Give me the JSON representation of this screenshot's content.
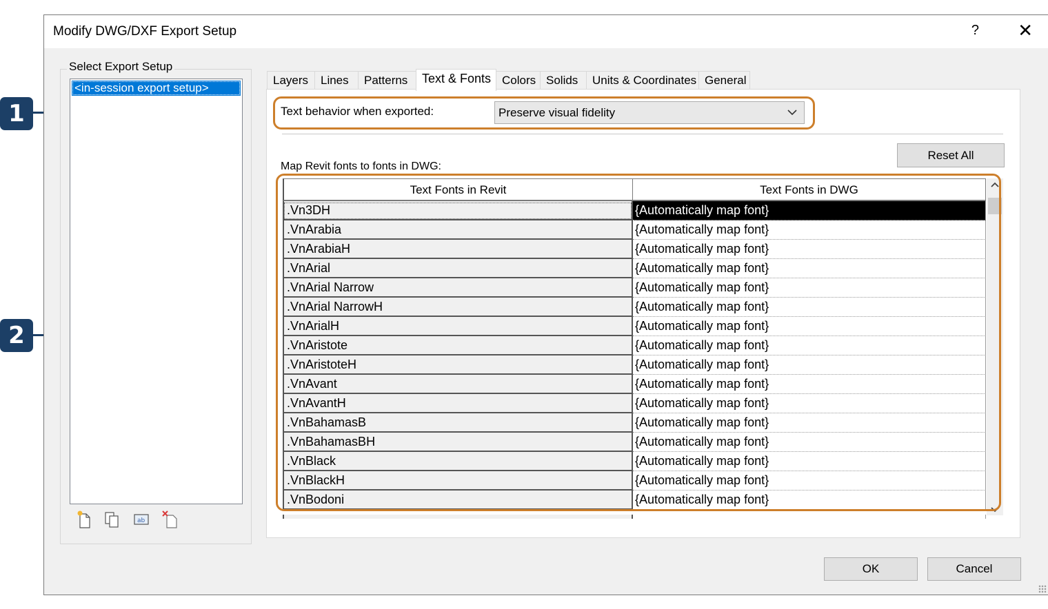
{
  "callouts": [
    "1",
    "2"
  ],
  "dialog": {
    "title": "Modify DWG/DXF Export Setup",
    "help": "?",
    "close": "✕"
  },
  "setup": {
    "group_label": "Select Export Setup",
    "items": [
      "<in-session export setup>"
    ]
  },
  "tabs": [
    "Layers",
    "Lines",
    "Patterns",
    "Text & Fonts",
    "Colors",
    "Solids",
    "Units & Coordinates",
    "General"
  ],
  "active_tab": "Text & Fonts",
  "text_behavior": {
    "label": "Text behavior when exported:",
    "value": "Preserve visual fidelity"
  },
  "reset_all": "Reset All",
  "map_label": "Map Revit fonts to fonts in DWG:",
  "table": {
    "columns": [
      "Text Fonts in Revit",
      "Text Fonts in DWG"
    ],
    "rows": [
      [
        ".Vn3DH",
        "{Automatically map font}"
      ],
      [
        ".VnArabia",
        "{Automatically map font}"
      ],
      [
        ".VnArabiaH",
        "{Automatically map font}"
      ],
      [
        ".VnArial",
        "{Automatically map font}"
      ],
      [
        ".VnArial Narrow",
        "{Automatically map font}"
      ],
      [
        ".VnArial NarrowH",
        "{Automatically map font}"
      ],
      [
        ".VnArialH",
        "{Automatically map font}"
      ],
      [
        ".VnAristote",
        "{Automatically map font}"
      ],
      [
        ".VnAristoteH",
        "{Automatically map font}"
      ],
      [
        ".VnAvant",
        "{Automatically map font}"
      ],
      [
        ".VnAvantH",
        "{Automatically map font}"
      ],
      [
        ".VnBahamasB",
        "{Automatically map font}"
      ],
      [
        ".VnBahamasBH",
        "{Automatically map font}"
      ],
      [
        ".VnBlack",
        "{Automatically map font}"
      ],
      [
        ".VnBlackH",
        "{Automatically map font}"
      ],
      [
        ".VnBodoni",
        "{Automatically map font}"
      ]
    ],
    "selected_row": 0
  },
  "buttons": {
    "ok": "OK",
    "cancel": "Cancel"
  },
  "colors": {
    "callout": "#1c3f66",
    "highlight": "#cd7f2b",
    "selection": "#0078d7"
  }
}
